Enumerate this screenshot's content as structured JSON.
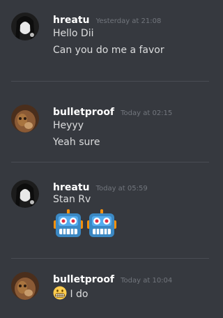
{
  "messages": [
    {
      "author": "hreatu",
      "timestamp": "Yesterday at 21:08",
      "lines": [
        "Hello Dii",
        "Can you do me a favor"
      ]
    },
    {
      "author": "bulletproof",
      "timestamp": "Today at 02:15",
      "lines": [
        "Heyyy",
        "Yeah sure"
      ]
    },
    {
      "author": "hreatu",
      "timestamp": "Today at 05:59",
      "lines": [
        "Stan Rv"
      ],
      "emojis": [
        "robot-face-emoji",
        "robot-face-emoji"
      ]
    },
    {
      "author": "bulletproof",
      "timestamp": "Today at 10:04",
      "lines": [
        "I do"
      ],
      "inline_emoji": "grimacing-face-emoji"
    }
  ],
  "colors": {
    "background": "#36393f",
    "author": "#ffffff",
    "timestamp": "#72767d",
    "text": "#dcddde"
  }
}
